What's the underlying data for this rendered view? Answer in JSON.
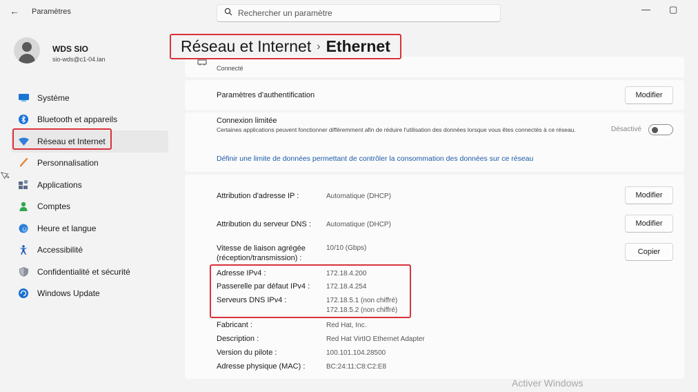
{
  "titlebar": {
    "back_glyph": "←",
    "app_title": "Paramètres",
    "search_placeholder": "Rechercher un paramètre",
    "minimize_glyph": "—",
    "maximize_glyph": "▢"
  },
  "profile": {
    "name": "WDS SIO",
    "email": "sio-wds@c1-04.lan"
  },
  "nav": {
    "items": [
      {
        "label": "Système",
        "icon": "monitor-icon"
      },
      {
        "label": "Bluetooth et appareils",
        "icon": "bluetooth-icon"
      },
      {
        "label": "Réseau et Internet",
        "icon": "wifi-icon",
        "active": true
      },
      {
        "label": "Personnalisation",
        "icon": "brush-icon"
      },
      {
        "label": "Applications",
        "icon": "apps-icon"
      },
      {
        "label": "Comptes",
        "icon": "person-icon"
      },
      {
        "label": "Heure et langue",
        "icon": "clock-globe-icon"
      },
      {
        "label": "Accessibilité",
        "icon": "accessibility-icon"
      },
      {
        "label": "Confidentialité et sécurité",
        "icon": "shield-icon"
      },
      {
        "label": "Windows Update",
        "icon": "update-icon"
      }
    ]
  },
  "breadcrumb": {
    "parent": "Réseau et Internet",
    "separator": "›",
    "current": "Ethernet"
  },
  "connection": {
    "status": "Connecté"
  },
  "auth": {
    "label": "Paramètres d'authentification",
    "button": "Modifier"
  },
  "metered": {
    "title": "Connexion limitée",
    "description": "Certaines applications peuvent fonctionner différemment afin de réduire l'utilisation des données lorsque vous êtes connectés à ce réseau.",
    "toggle_label": "Désactivé",
    "toggle_on": false,
    "link": "Définir une limite de données permettant de contrôler la consommation des données sur ce réseau"
  },
  "ip_settings": {
    "ip_assignment_label": "Attribution d'adresse IP :",
    "ip_assignment_value": "Automatique (DHCP)",
    "ip_assignment_button": "Modifier",
    "dns_assignment_label": "Attribution du serveur DNS :",
    "dns_assignment_value": "Automatique (DHCP)",
    "dns_assignment_button": "Modifier",
    "link_speed_label_1": "Vitesse de liaison agrégée",
    "link_speed_label_2": "(réception/transmission) :",
    "link_speed_value": "10/10 (Gbps)",
    "copy_button": "Copier",
    "ipv4_label": "Adresse IPv4 :",
    "ipv4_value": "172.18.4.200",
    "gateway_label": "Passerelle par défaut IPv4 :",
    "gateway_value": "172.18.4.254",
    "dns_label": "Serveurs DNS IPv4 :",
    "dns_value_1": "172.18.5.1 (non chiffré)",
    "dns_value_2": "172.18.5.2 (non chiffré)",
    "manufacturer_label": "Fabricant :",
    "manufacturer_value": "Red Hat, Inc.",
    "description_label": "Description :",
    "description_value": "Red Hat VirtIO Ethernet Adapter",
    "driver_label": "Version du pilote :",
    "driver_value": "100.101.104.28500",
    "mac_label": "Adresse physique (MAC) :",
    "mac_value": "BC:24:11:C8:C2:E8"
  },
  "watermark": "Activer Windows",
  "colors": {
    "highlight": "#d9303a",
    "link": "#1b5aa8",
    "accent": "#0067c0"
  }
}
